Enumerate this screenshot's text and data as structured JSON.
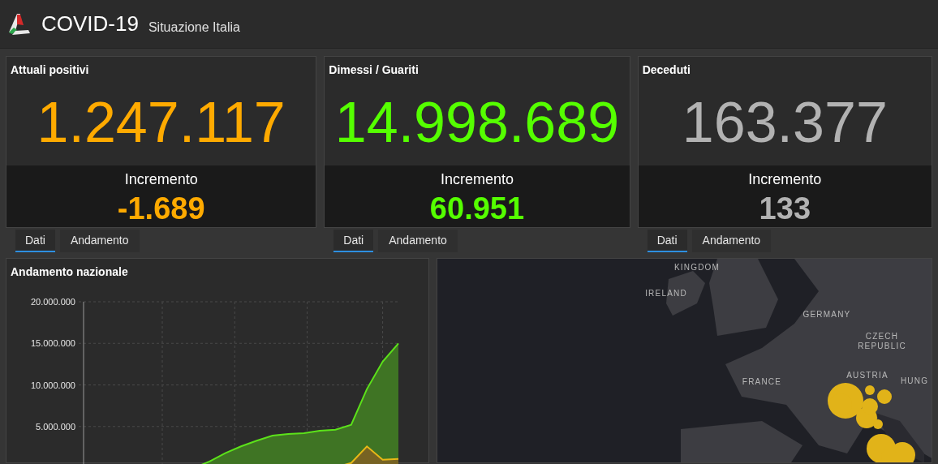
{
  "header": {
    "title": "COVID-19",
    "subtitle": "Situazione Italia"
  },
  "cards": [
    {
      "title": "Attuali positivi",
      "value": "1.247.117",
      "increment_label": "Incremento",
      "increment": "-1.689",
      "color": "#ffaa00",
      "tabs": [
        {
          "label": "Dati",
          "selected": true
        },
        {
          "label": "Andamento",
          "selected": false
        }
      ]
    },
    {
      "title": "Dimessi / Guariti",
      "value": "14.998.689",
      "increment_label": "Incremento",
      "increment": "60.951",
      "color": "#55ff00",
      "tabs": [
        {
          "label": "Dati",
          "selected": true
        },
        {
          "label": "Andamento",
          "selected": false
        }
      ]
    },
    {
      "title": "Deceduti",
      "value": "163.377",
      "increment_label": "Incremento",
      "increment": "133",
      "color": "#b2b2b2",
      "tabs": [
        {
          "label": "Dati",
          "selected": true
        },
        {
          "label": "Andamento",
          "selected": false
        }
      ]
    }
  ],
  "chart_panel": {
    "title": "Andamento nazionale",
    "chart_data": {
      "type": "area",
      "grid": true,
      "categories": [
        null,
        null,
        null,
        null,
        null,
        null,
        null,
        null,
        null,
        null,
        null,
        null,
        null,
        null,
        null,
        null,
        null,
        null,
        null,
        null,
        null
      ],
      "ylim": [
        0,
        20000000
      ],
      "yticks": [
        {
          "value": 5000000,
          "label": "5.000.000"
        },
        {
          "value": 10000000,
          "label": "10.000.000"
        },
        {
          "value": 15000000,
          "label": "15.000.000"
        },
        {
          "value": 20000000,
          "label": "20.000.000"
        }
      ],
      "series": [
        {
          "color": "#5ce21a",
          "values": [
            null,
            null,
            null,
            null,
            null,
            null,
            null,
            0,
            800000,
            1800000,
            2600000,
            3300000,
            3900000,
            4100000,
            4200000,
            4500000,
            4600000,
            5200000,
            9500000,
            12800000,
            15000000
          ]
        },
        {
          "color": "#e8b817",
          "values": [
            null,
            null,
            null,
            null,
            null,
            null,
            null,
            200000,
            100000,
            100000,
            100000,
            100000,
            100000,
            100000,
            100000,
            100000,
            100000,
            600000,
            2600000,
            1000000,
            1100000
          ]
        }
      ]
    }
  },
  "map": {
    "labels": [
      "KINGDOM",
      "IRELAND",
      "GERMANY",
      "CZECH REPUBLIC",
      "FRANCE",
      "AUSTRIA",
      "HUNG"
    ]
  }
}
